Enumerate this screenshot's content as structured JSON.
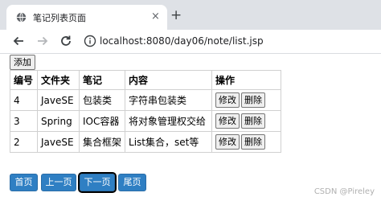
{
  "browser": {
    "tab_title": "笔记列表页面",
    "tab_close": "×",
    "new_tab": "+",
    "url": "localhost:8080/day06/note/list.jsp"
  },
  "page": {
    "add_label": "添加",
    "columns": [
      "编号",
      "文件夹",
      "笔记",
      "内容",
      "操作"
    ],
    "rows": [
      {
        "id": "4",
        "folder": "JaveSE",
        "note": "包装类",
        "content": "字符串包装类"
      },
      {
        "id": "3",
        "folder": "Spring",
        "note": "IOC容器",
        "content": "将对象管理权交给"
      },
      {
        "id": "2",
        "folder": "JaveSE",
        "note": "集合框架",
        "content": "List集合，set等"
      }
    ],
    "edit_label": "修改",
    "delete_label": "删除",
    "pager": {
      "first": "首页",
      "prev": "上一页",
      "next": "下一页",
      "last": "尾页"
    }
  },
  "watermark": "CSDN @Pireley"
}
